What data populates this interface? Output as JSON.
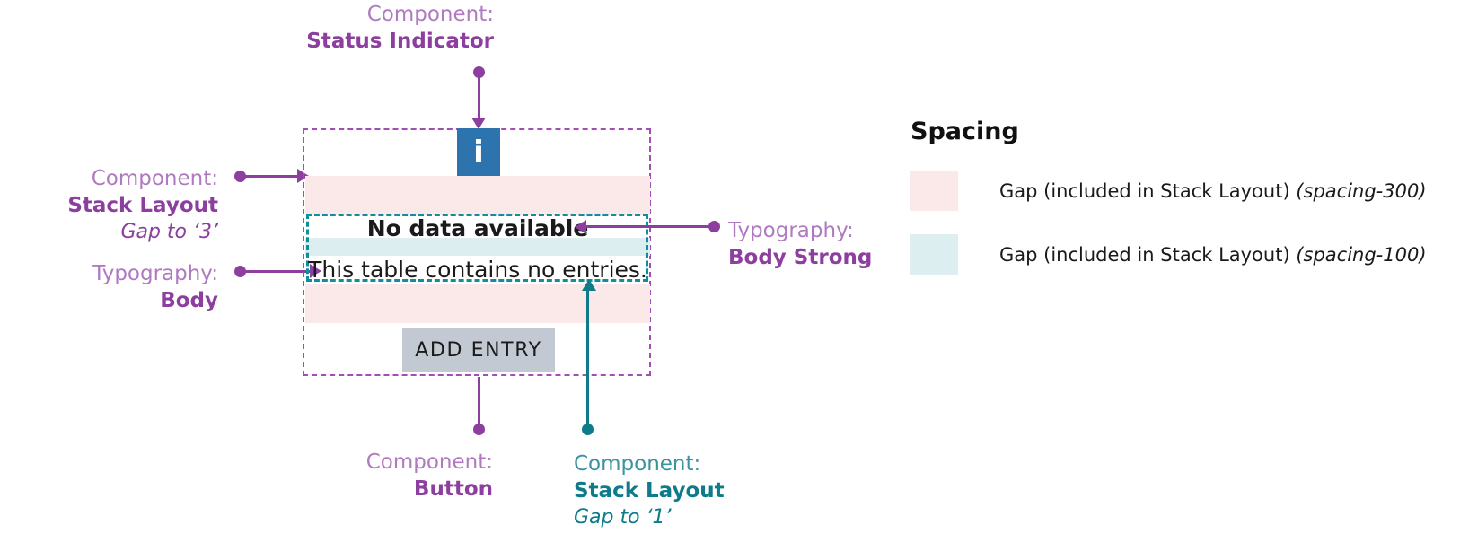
{
  "annotations": {
    "status_indicator": {
      "kind": "Component:",
      "value": "Status Indicator"
    },
    "stack_layout_outer": {
      "kind": "Component:",
      "value": "Stack Layout",
      "sub": "Gap to ‘3’"
    },
    "typography_body": {
      "kind": "Typography:",
      "value": "Body"
    },
    "typography_body_strong": {
      "kind": "Typography:",
      "value": "Body Strong"
    },
    "button": {
      "kind": "Component:",
      "value": "Button"
    },
    "stack_layout_inner": {
      "kind": "Component:",
      "value": "Stack Layout",
      "sub": "Gap to ‘1’"
    }
  },
  "component": {
    "status_icon": {
      "glyph": "i",
      "icon_name": "info-icon",
      "color": "#2d73ad"
    },
    "heading": "No data available",
    "body": "This table contains no entries.",
    "button_label": "ADD ENTRY",
    "button_color": "#c3c9d2"
  },
  "legend": {
    "title": "Spacing",
    "rows": [
      {
        "color": "#fae9e8",
        "label": "Gap (included in Stack Layout) ",
        "token": "(spacing-300)"
      },
      {
        "color": "#dceeef",
        "label": "Gap (included in Stack Layout) ",
        "token": "(spacing-100)"
      }
    ]
  },
  "colors": {
    "purple": "#8c3f9e",
    "purple_light": "#b07ac0",
    "teal": "#0d7b8a",
    "pink_band": "#fae9e8",
    "blue_band": "#dceeef"
  }
}
